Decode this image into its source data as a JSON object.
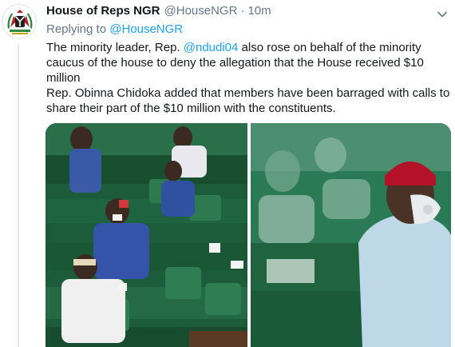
{
  "tweet": {
    "author": {
      "display_name": "House of Reps NGR",
      "handle": "@HouseNGR",
      "avatar_icon": "nigeria-coat-of-arms-icon"
    },
    "separator": "·",
    "timestamp": "10m",
    "reply_prefix": "Replying to",
    "reply_to": "@HouseNGR",
    "text": {
      "p1_before": "The minority leader, Rep. ",
      "p1_mention": "@ndudi04",
      "p1_after": " also rose on behalf of the minority caucus of the house to deny the allegation that the House received $10 million",
      "p2": "Rep. Obinna Chidoka added that members have been barraged with calls to share their part of the $10 million with the constituents."
    },
    "more_icon": "chevron-down-icon",
    "media": [
      {
        "name": "photo-chamber-members-seated"
      },
      {
        "name": "photo-member-with-red-cap"
      }
    ]
  },
  "colors": {
    "text": "#14171a",
    "muted": "#657786",
    "link": "#1da1f2",
    "chamber_green": "#1b5e3a"
  }
}
